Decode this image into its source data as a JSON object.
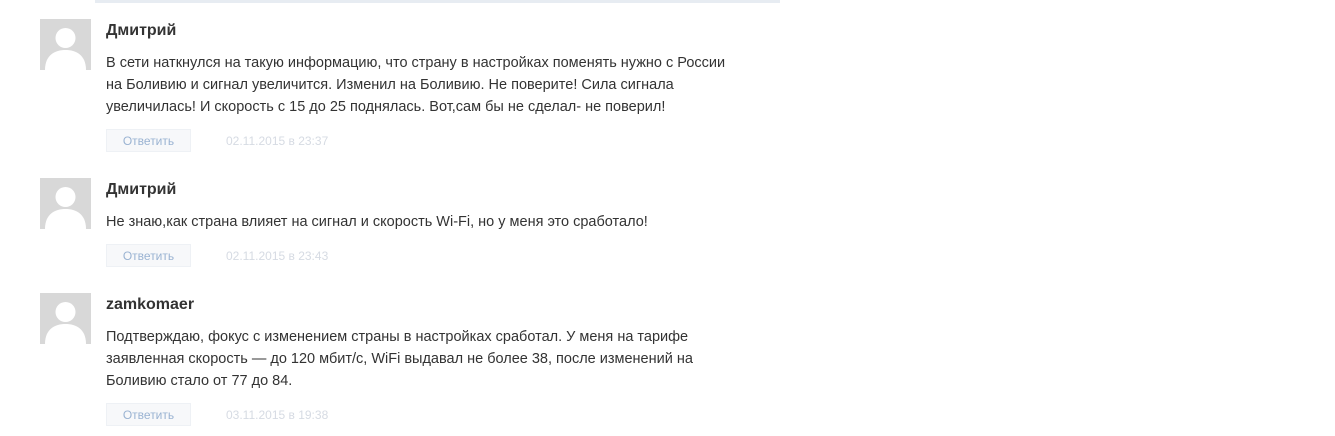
{
  "comments": [
    {
      "author": "Дмитрий",
      "lines": [
        "В сети наткнулся на такую информацию, что страну в настройках поменять нужно с России",
        "на Боливию и сигнал увеличится. Изменил на Боливию. Не поверите! Сила сигнала",
        "увеличилась! И скорость с 15 до 25 поднялась. Вот,сам бы не сделал- не поверил!"
      ],
      "reply_label": "Ответить",
      "date": "02.11.2015 в 23:37"
    },
    {
      "author": "Дмитрий",
      "lines": [
        "Не знаю,как страна влияет на сигнал и скорость Wi-Fi, но у меня это сработало!"
      ],
      "reply_label": "Ответить",
      "date": "02.11.2015 в 23:43"
    },
    {
      "author": "zamkomaer",
      "lines": [
        "Подтверждаю, фокус с изменением страны в настройках сработал. У меня на тарифе",
        "заявленная скорость — до 120 мбит/с, WiFi выдавал не более 38, после изменений на",
        "Боливию стало от 77 до 84."
      ],
      "reply_label": "Ответить",
      "date": "03.11.2015 в 19:38"
    }
  ]
}
